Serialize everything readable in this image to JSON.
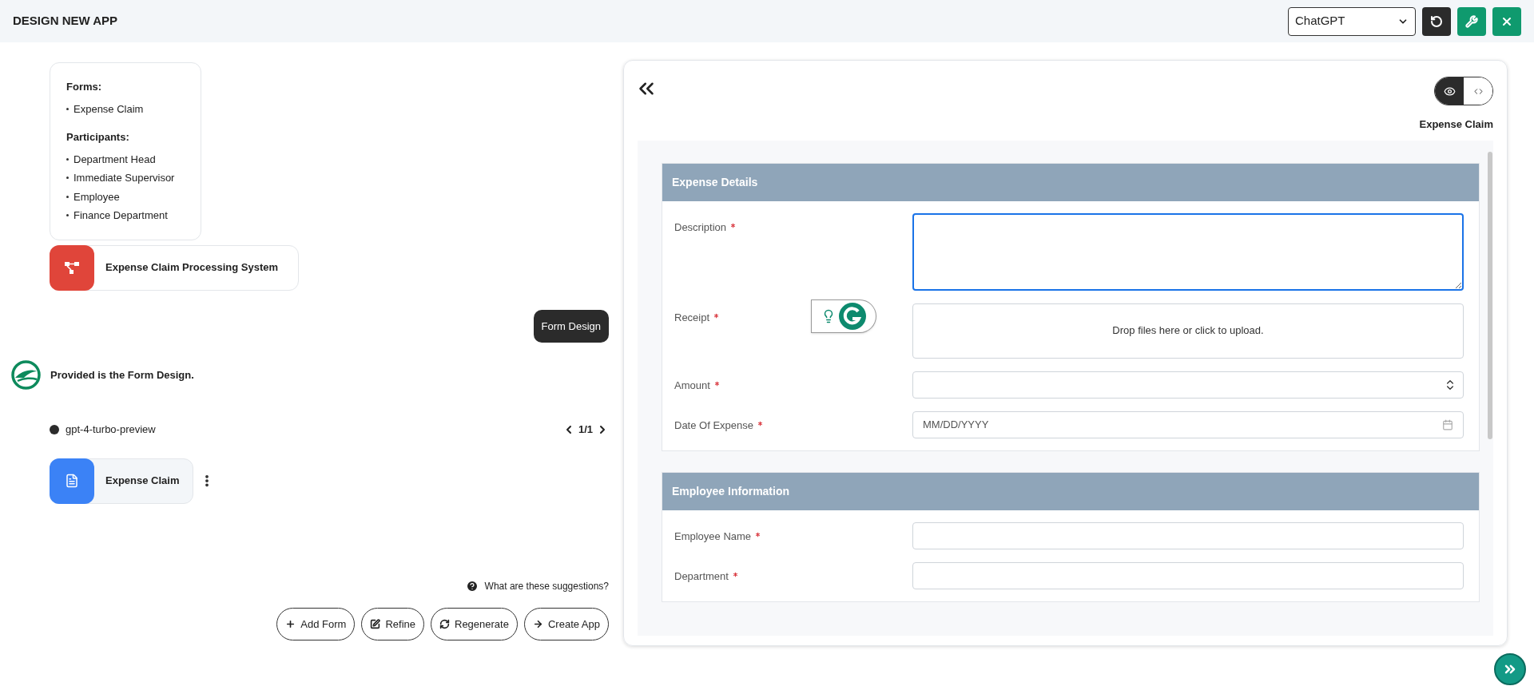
{
  "header": {
    "title": "DESIGN NEW APP",
    "model_select": {
      "value": "ChatGPT"
    },
    "buttons": [
      {
        "kind": "reset"
      },
      {
        "kind": "settings"
      },
      {
        "kind": "close"
      }
    ]
  },
  "chat": {
    "summary": {
      "sections": [
        {
          "title": "Forms:",
          "items": [
            "Expense Claim"
          ]
        },
        {
          "title": "Participants:",
          "items": [
            "Department Head",
            "Immediate Supervisor",
            "Employee",
            "Finance Department"
          ]
        }
      ]
    },
    "process_card": {
      "label": "Expense Claim Processing System"
    },
    "user_message": "Form Design",
    "assistant_message": "Provided is the Form Design.",
    "model": {
      "name": "gpt-4-turbo-preview",
      "page": "1/1"
    },
    "form_card": {
      "label": "Expense Claim"
    },
    "help_link": "What are these suggestions?",
    "actions": [
      {
        "kind": "add",
        "label": "Add Form"
      },
      {
        "kind": "edit",
        "label": "Refine"
      },
      {
        "kind": "regenerate",
        "label": "Regenerate"
      },
      {
        "kind": "next",
        "label": "Create App"
      }
    ]
  },
  "preview": {
    "view_toggle": [
      {
        "kind": "preview",
        "selected": true
      },
      {
        "kind": "code",
        "selected": false
      }
    ],
    "form_title": "Expense Claim",
    "sections": [
      {
        "title": "Expense Details",
        "fields": [
          {
            "label": "Description",
            "required": true,
            "kind": "textarea",
            "focused": true
          },
          {
            "label": "Receipt",
            "required": true,
            "kind": "file",
            "prompt": "Drop files here or click to upload."
          },
          {
            "label": "Amount",
            "required": true,
            "kind": "number",
            "focused": false
          },
          {
            "label": "Date Of Expense",
            "required": true,
            "kind": "date",
            "placeholder": "MM/DD/YYYY",
            "focused": false
          }
        ]
      },
      {
        "title": "Employee Information",
        "fields": [
          {
            "label": "Employee Name",
            "required": true,
            "kind": "text",
            "focused": false
          },
          {
            "label": "Department",
            "required": true,
            "kind": "text",
            "focused": false
          }
        ]
      }
    ]
  }
}
